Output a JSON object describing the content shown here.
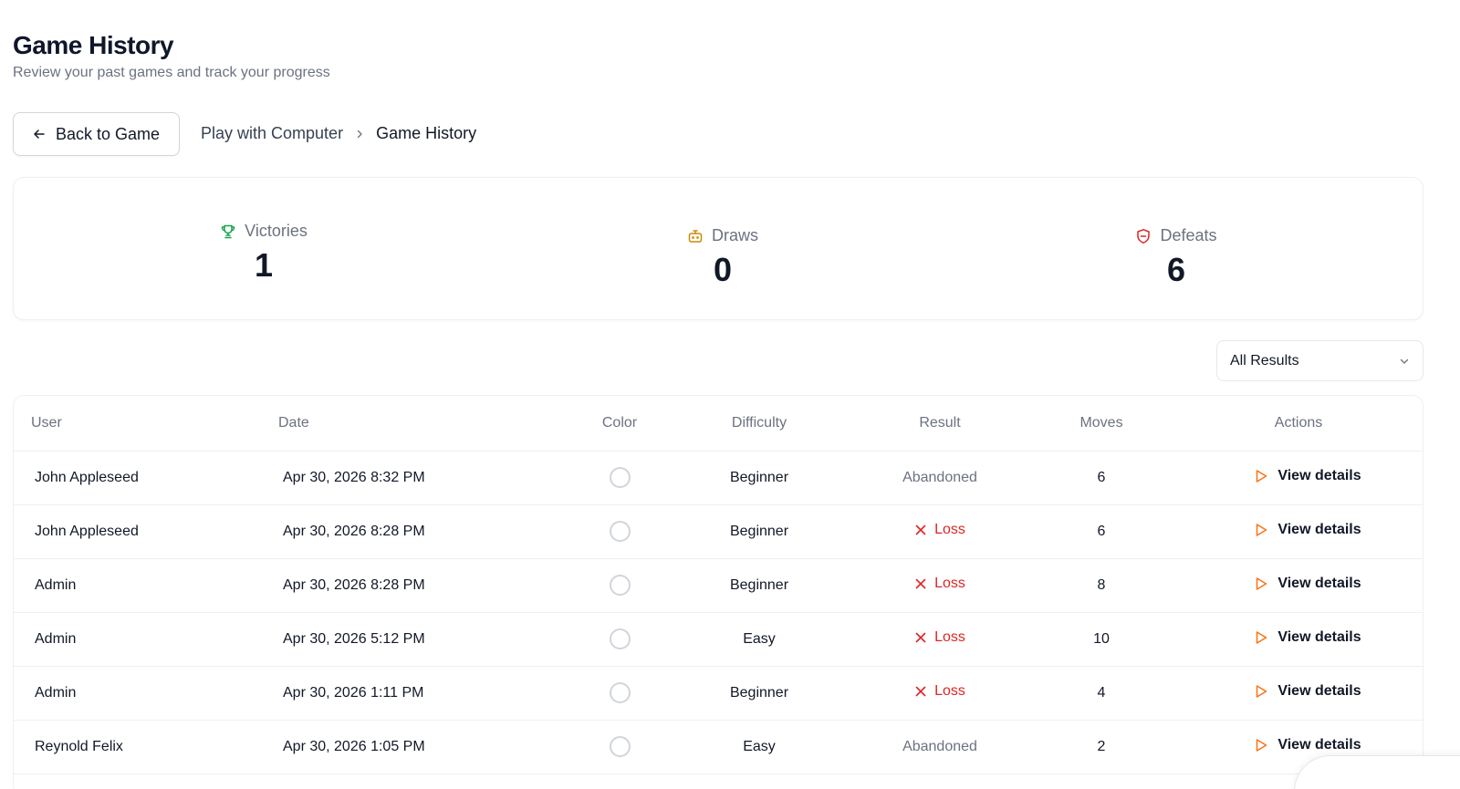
{
  "header": {
    "title": "Game History",
    "subtitle": "Review your past games and track your progress"
  },
  "nav": {
    "back_label": "Back to Game",
    "breadcrumb": [
      "Play with Computer",
      "Game History"
    ]
  },
  "stats": {
    "victories": {
      "label": "Victories",
      "value": "1",
      "icon": "trophy-icon",
      "color": "#16a34a"
    },
    "draws": {
      "label": "Draws",
      "value": "0",
      "icon": "robot-icon",
      "color": "#ca8a04"
    },
    "defeats": {
      "label": "Defeats",
      "value": "6",
      "icon": "shield-icon",
      "color": "#dc2626"
    }
  },
  "filter": {
    "selected": "All Results"
  },
  "table": {
    "columns": [
      "User",
      "Date",
      "Color",
      "Difficulty",
      "Result",
      "Moves",
      "Actions"
    ],
    "rows": [
      {
        "user": "John Appleseed",
        "date": "Apr 30, 2026 8:32 PM",
        "difficulty": "Beginner",
        "result": "Abandoned",
        "moves": "6",
        "action": "View details"
      },
      {
        "user": "John Appleseed",
        "date": "Apr 30, 2026 8:28 PM",
        "difficulty": "Beginner",
        "result": "Loss",
        "moves": "6",
        "action": "View details"
      },
      {
        "user": "Admin",
        "date": "Apr 30, 2026 8:28 PM",
        "difficulty": "Beginner",
        "result": "Loss",
        "moves": "8",
        "action": "View details"
      },
      {
        "user": "Admin",
        "date": "Apr 30, 2026 5:12 PM",
        "difficulty": "Easy",
        "result": "Loss",
        "moves": "10",
        "action": "View details"
      },
      {
        "user": "Admin",
        "date": "Apr 30, 2026 1:11 PM",
        "difficulty": "Beginner",
        "result": "Loss",
        "moves": "4",
        "action": "View details"
      },
      {
        "user": "Reynold Felix",
        "date": "Apr 30, 2026 1:05 PM",
        "difficulty": "Easy",
        "result": "Abandoned",
        "moves": "2",
        "action": "View details"
      }
    ]
  },
  "colors": {
    "accent_orange": "#f97316",
    "loss_red": "#dc2626",
    "muted_gray": "#6b7280"
  }
}
